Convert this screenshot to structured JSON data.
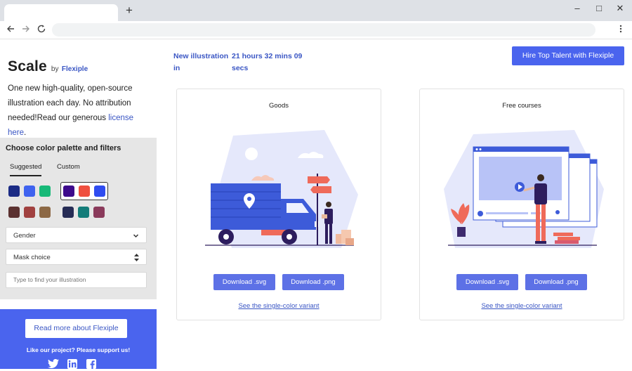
{
  "browser": {
    "new_tab_symbol": "+",
    "window_controls": [
      "–",
      "□",
      "✕"
    ],
    "nav": {
      "back_icon": "back-arrow-icon",
      "forward_icon": "forward-arrow-icon",
      "reload_icon": "reload-icon"
    }
  },
  "brand": {
    "name": "Scale",
    "by": "by",
    "company": "Flexiple"
  },
  "intro": {
    "text": "One new high-quality, open-source illustration each day. No attribution needed!Read our generous ",
    "link": "license here",
    "suffix": "."
  },
  "filters": {
    "title": "Choose color palette and filters",
    "tabs": [
      {
        "label": "Suggested",
        "active": true
      },
      {
        "label": "Custom",
        "active": false
      }
    ],
    "palettes": [
      {
        "colors": [
          "#1b2b85",
          "#3f63ef",
          "#17b978"
        ],
        "selected": false
      },
      {
        "colors": [
          "#3d0a8c",
          "#ef4f3f",
          "#2f4cf0"
        ],
        "selected": true
      },
      {
        "colors": [
          "#5b3130",
          "#a14140",
          "#8c6845"
        ],
        "selected": false
      },
      {
        "colors": [
          "#262c55",
          "#137c79",
          "#8a3a5b"
        ],
        "selected": false
      }
    ],
    "gender": {
      "value": "Gender"
    },
    "mask": {
      "value": "Mask choice"
    },
    "search": {
      "placeholder": "Type to find your illustration"
    }
  },
  "support": {
    "button": "Read more about Flexiple",
    "text": "Like our project? Please support us!",
    "social": [
      "twitter-icon",
      "linkedin-icon",
      "facebook-icon"
    ]
  },
  "countdown": {
    "label": "New illustration in",
    "value": "21 hours 32 mins 09 secs"
  },
  "hire_button": "Hire Top Talent with Flexiple",
  "cards": [
    {
      "title": "Goods",
      "download_svg": "Download .svg",
      "download_png": "Download .png",
      "variant": "See the single-color variant"
    },
    {
      "title": "Free courses",
      "download_svg": "Download .svg",
      "download_png": "Download .png",
      "variant": "See the single-color variant"
    }
  ],
  "colors": {
    "accent": "#4a64ee",
    "link": "#3a56c4",
    "illus_bg": "#e5e8fb"
  }
}
